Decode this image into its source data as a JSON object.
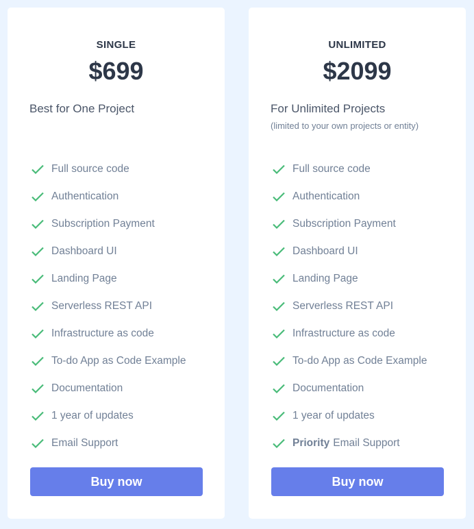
{
  "colors": {
    "background": "#ebf4ff",
    "accent": "#667eea",
    "check": "#48bb78"
  },
  "plans": [
    {
      "name": "SINGLE",
      "price": "$699",
      "tagline": "Best for One Project",
      "note": "",
      "features": [
        {
          "bold": "",
          "text": "Full source code"
        },
        {
          "bold": "",
          "text": "Authentication"
        },
        {
          "bold": "",
          "text": "Subscription Payment"
        },
        {
          "bold": "",
          "text": "Dashboard UI"
        },
        {
          "bold": "",
          "text": "Landing Page"
        },
        {
          "bold": "",
          "text": "Serverless REST API"
        },
        {
          "bold": "",
          "text": "Infrastructure as code"
        },
        {
          "bold": "",
          "text": "To-do App as Code Example"
        },
        {
          "bold": "",
          "text": "Documentation"
        },
        {
          "bold": "",
          "text": "1 year of updates"
        },
        {
          "bold": "",
          "text": "Email Support"
        }
      ],
      "button_label": "Buy now"
    },
    {
      "name": "UNLIMITED",
      "price": "$2099",
      "tagline": "For Unlimited Projects",
      "note": "(limited to your own projects or entity)",
      "features": [
        {
          "bold": "",
          "text": "Full source code"
        },
        {
          "bold": "",
          "text": "Authentication"
        },
        {
          "bold": "",
          "text": "Subscription Payment"
        },
        {
          "bold": "",
          "text": "Dashboard UI"
        },
        {
          "bold": "",
          "text": "Landing Page"
        },
        {
          "bold": "",
          "text": "Serverless REST API"
        },
        {
          "bold": "",
          "text": "Infrastructure as code"
        },
        {
          "bold": "",
          "text": "To-do App as Code Example"
        },
        {
          "bold": "",
          "text": "Documentation"
        },
        {
          "bold": "",
          "text": "1 year of updates"
        },
        {
          "bold": "Priority",
          "text": "Email Support"
        }
      ],
      "button_label": "Buy now"
    }
  ]
}
